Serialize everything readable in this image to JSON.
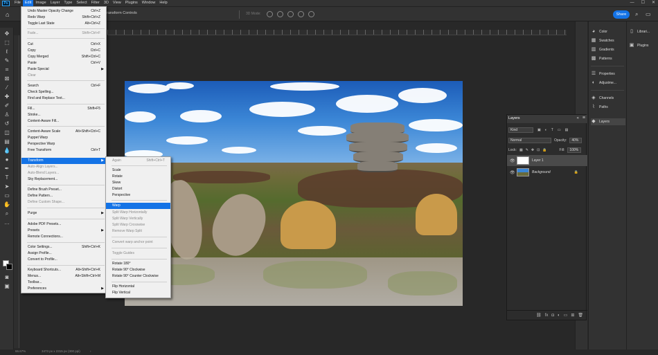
{
  "menubar": {
    "logo": "Ps",
    "items": [
      "File",
      "Edit",
      "Image",
      "Layer",
      "Type",
      "Select",
      "Filter",
      "3D",
      "View",
      "Plugins",
      "Window",
      "Help"
    ],
    "window_controls": [
      "—",
      "☐",
      "✕"
    ]
  },
  "options": {
    "transform_label": "ransform Controls",
    "mode_label": "3D Mode:",
    "share": "Share"
  },
  "edit_menu": {
    "items": [
      {
        "label": "Undo Master Opacity Change",
        "shortcut": "Ctrl+Z",
        "disabled": false
      },
      {
        "label": "Redo Warp",
        "shortcut": "Shift+Ctrl+Z",
        "disabled": false
      },
      {
        "label": "Toggle Last State",
        "shortcut": "Alt+Ctrl+Z",
        "disabled": false
      },
      {
        "label": "Fade...",
        "shortcut": "Shift+Ctrl+F",
        "disabled": true
      },
      {
        "label": "Cut",
        "shortcut": "Ctrl+X",
        "disabled": false
      },
      {
        "label": "Copy",
        "shortcut": "Ctrl+C",
        "disabled": false
      },
      {
        "label": "Copy Merged",
        "shortcut": "Shift+Ctrl+C",
        "disabled": false
      },
      {
        "label": "Paste",
        "shortcut": "Ctrl+V",
        "disabled": false
      },
      {
        "label": "Paste Special",
        "shortcut": "",
        "disabled": false
      },
      {
        "label": "Clear",
        "shortcut": "",
        "disabled": false
      },
      {
        "label": "Search",
        "shortcut": "Ctrl+F",
        "disabled": false
      },
      {
        "label": "Check Spelling...",
        "shortcut": "",
        "disabled": false
      },
      {
        "label": "Find and Replace Text...",
        "shortcut": "",
        "disabled": false
      },
      {
        "label": "Fill...",
        "shortcut": "Shift+F5",
        "disabled": false
      },
      {
        "label": "Stroke...",
        "shortcut": "",
        "disabled": false
      },
      {
        "label": "Content-Aware Fill...",
        "shortcut": "",
        "disabled": false
      },
      {
        "label": "Content-Aware Scale",
        "shortcut": "Alt+Shift+Ctrl+C",
        "disabled": false
      },
      {
        "label": "Puppet Warp",
        "shortcut": "",
        "disabled": false
      },
      {
        "label": "Perspective Warp",
        "shortcut": "",
        "disabled": false
      },
      {
        "label": "Free Transform",
        "shortcut": "Ctrl+T",
        "disabled": false
      },
      {
        "label": "Transform",
        "shortcut": "",
        "disabled": false
      },
      {
        "label": "Auto-Align Layers...",
        "shortcut": "",
        "disabled": true
      },
      {
        "label": "Auto-Blend Layers...",
        "shortcut": "",
        "disabled": true
      },
      {
        "label": "Sky Replacement...",
        "shortcut": "",
        "disabled": false
      },
      {
        "label": "Define Brush Preset...",
        "shortcut": "",
        "disabled": false
      },
      {
        "label": "Define Pattern...",
        "shortcut": "",
        "disabled": false
      },
      {
        "label": "Define Custom Shape...",
        "shortcut": "",
        "disabled": true
      },
      {
        "label": "Purge",
        "shortcut": "",
        "disabled": false
      },
      {
        "label": "Adobe PDF Presets...",
        "shortcut": "",
        "disabled": false
      },
      {
        "label": "Presets",
        "shortcut": "",
        "disabled": false
      },
      {
        "label": "Remote Connections...",
        "shortcut": "",
        "disabled": false
      },
      {
        "label": "Color Settings...",
        "shortcut": "Shift+Ctrl+K",
        "disabled": false
      },
      {
        "label": "Assign Profile...",
        "shortcut": "",
        "disabled": false
      },
      {
        "label": "Convert to Profile...",
        "shortcut": "",
        "disabled": false
      },
      {
        "label": "Keyboard Shortcuts...",
        "shortcut": "Alt+Shift+Ctrl+K",
        "disabled": false
      },
      {
        "label": "Menus...",
        "shortcut": "Alt+Shift+Ctrl+M",
        "disabled": false
      },
      {
        "label": "Toolbar...",
        "shortcut": "",
        "disabled": false
      },
      {
        "label": "Preferences",
        "shortcut": "",
        "disabled": false
      }
    ]
  },
  "transform_submenu": {
    "items": [
      {
        "label": "Again",
        "shortcut": "Shift+Ctrl+T",
        "disabled": true
      },
      {
        "label": "Scale",
        "shortcut": "",
        "disabled": false
      },
      {
        "label": "Rotate",
        "shortcut": "",
        "disabled": false
      },
      {
        "label": "Skew",
        "shortcut": "",
        "disabled": false
      },
      {
        "label": "Distort",
        "shortcut": "",
        "disabled": false
      },
      {
        "label": "Perspective",
        "shortcut": "",
        "disabled": false
      },
      {
        "label": "Warp",
        "shortcut": "",
        "disabled": false
      },
      {
        "label": "Split Warp Horizontally",
        "shortcut": "",
        "disabled": true
      },
      {
        "label": "Split Warp Vertically",
        "shortcut": "",
        "disabled": true
      },
      {
        "label": "Split Warp Crosswise",
        "shortcut": "",
        "disabled": true
      },
      {
        "label": "Remove Warp Split",
        "shortcut": "",
        "disabled": true
      },
      {
        "label": "Convert warp anchor point",
        "shortcut": "",
        "disabled": true
      },
      {
        "label": "Toggle Guides",
        "shortcut": "",
        "disabled": true
      },
      {
        "label": "Rotate 180°",
        "shortcut": "",
        "disabled": false
      },
      {
        "label": "Rotate 90° Clockwise",
        "shortcut": "",
        "disabled": false
      },
      {
        "label": "Rotate 90° Counter Clockwise",
        "shortcut": "",
        "disabled": false
      },
      {
        "label": "Flip Horizontal",
        "shortcut": "",
        "disabled": false
      },
      {
        "label": "Flip Vertical",
        "shortcut": "",
        "disabled": false
      }
    ]
  },
  "dock_right": {
    "items": [
      "Color",
      "Swatches",
      "Gradients",
      "Patterns",
      "Properties",
      "Adjustme...",
      "Channels",
      "Paths",
      "Layers"
    ]
  },
  "dock_far": {
    "items": [
      "Librari...",
      "Plugins"
    ]
  },
  "layers_panel": {
    "tab": "Layers",
    "filter": "Kind",
    "blend_mode": "Normal",
    "opacity_label": "Opacity:",
    "opacity_value": "40%",
    "lock_label": "Lock:",
    "fill_label": "Fill:",
    "fill_value": "100%",
    "layers": [
      {
        "name": "Layer 1",
        "selected": true
      },
      {
        "name": "Background",
        "selected": false
      }
    ]
  },
  "status": {
    "zoom": "66.67%",
    "doc_size": "3473 px x 2315 px (300 ppi)"
  },
  "colors": {
    "accent": "#1473e6",
    "panel": "#323232",
    "canvas_bg": "#282828"
  }
}
